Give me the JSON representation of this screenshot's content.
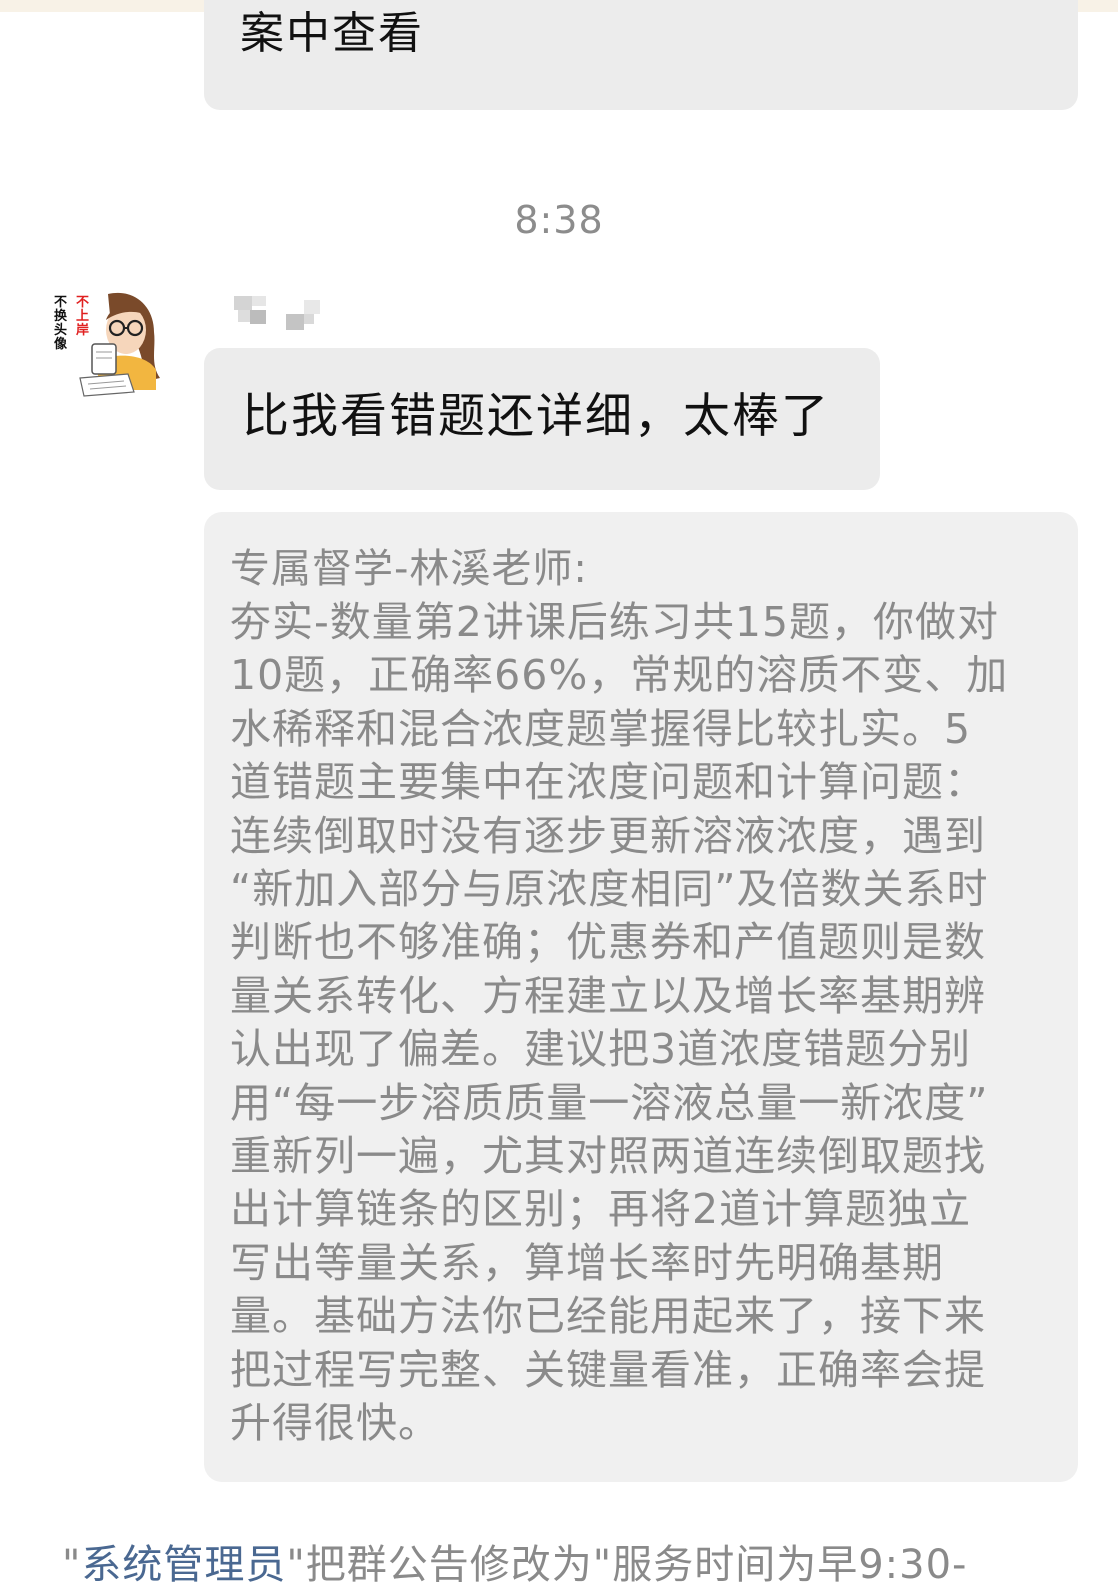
{
  "previous_message": {
    "text_fragment": "案中查看"
  },
  "timestamp": "8:38",
  "avatar": {
    "badge_line1": "不上岸",
    "badge_line2": "不换头像"
  },
  "received_message": {
    "text": "比我看错题还详细，太棒了"
  },
  "tutor_note": {
    "heading": "专属督学-林溪老师:",
    "lines": [
      "夯实-数量第2讲课后练习共15题，你做对",
      "10题，正确率66%，常规的溶质不变、加",
      "水稀释和混合浓度题掌握得比较扎实。5",
      "道错题主要集中在浓度问题和计算问题：",
      "连续倒取时没有逐步更新溶液浓度，遇到",
      "“新加入部分与原浓度相同”及倍数关系时",
      "判断也不够准确；优惠券和产值题则是数",
      "量关系转化、方程建立以及增长率基期辨",
      "认出现了偏差。建议把3道浓度错题分别",
      "用“每一步溶质质量一溶液总量一新浓度”",
      "重新列一遍，尤其对照两道连续倒取题找",
      "出计算链条的区别；再将2道计算题独立",
      "写出等量关系，算增长率时先明确基期",
      "量。基础方法你已经能用起来了，接下来",
      "把过程写完整、关键量看准，正确率会提",
      "升得很快。"
    ]
  },
  "system_notice": {
    "quote_open": "\"",
    "actor": "系统管理员",
    "action": "\"把群公告修改为\"服务时间为早9:30-"
  },
  "colors": {
    "bubble_bg": "#ececec",
    "note_bg": "#f0f0f0",
    "note_text": "#8a8a8a",
    "link": "#4a6891",
    "timestamp": "#8c8c8c"
  }
}
